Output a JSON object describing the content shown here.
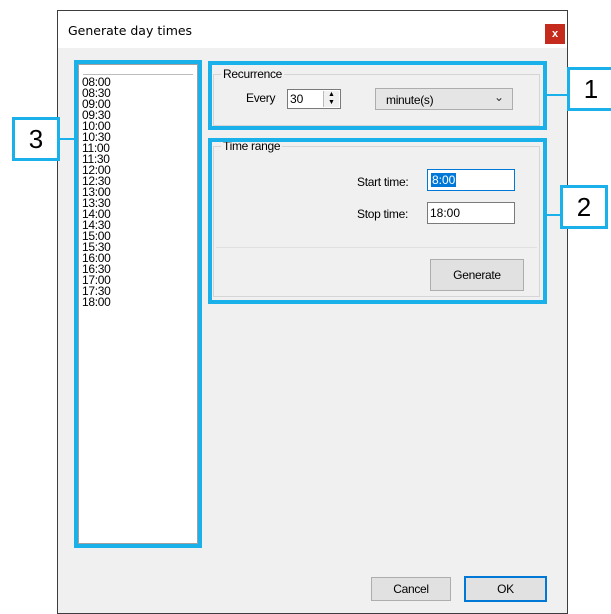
{
  "window": {
    "title": "Generate day times",
    "close_glyph": "x"
  },
  "time_list": {
    "items": [
      "08:00",
      "08:30",
      "09:00",
      "09:30",
      "10:00",
      "10:30",
      "11:00",
      "11:30",
      "12:00",
      "12:30",
      "13:00",
      "13:30",
      "14:00",
      "14:30",
      "15:00",
      "15:30",
      "16:00",
      "16:30",
      "17:00",
      "17:30",
      "18:00"
    ]
  },
  "recurrence": {
    "group_label": "Recurrence",
    "every_label": "Every",
    "every_value": "30",
    "unit_selected": "minute(s)"
  },
  "time_range": {
    "group_label": "Time range",
    "start_label": "Start time:",
    "start_value": "8:00",
    "stop_label": "Stop time:",
    "stop_value": "18:00",
    "generate_label": "Generate"
  },
  "footer": {
    "cancel_label": "Cancel",
    "ok_label": "OK"
  },
  "annotations": {
    "callout_1": "1",
    "callout_2": "2",
    "callout_3": "3",
    "color": "#1ab1ea"
  },
  "icons": {
    "close": "close-icon",
    "spin_up": "spin-up-icon",
    "spin_down": "spin-down-icon",
    "dropdown": "chevron-down-icon"
  }
}
